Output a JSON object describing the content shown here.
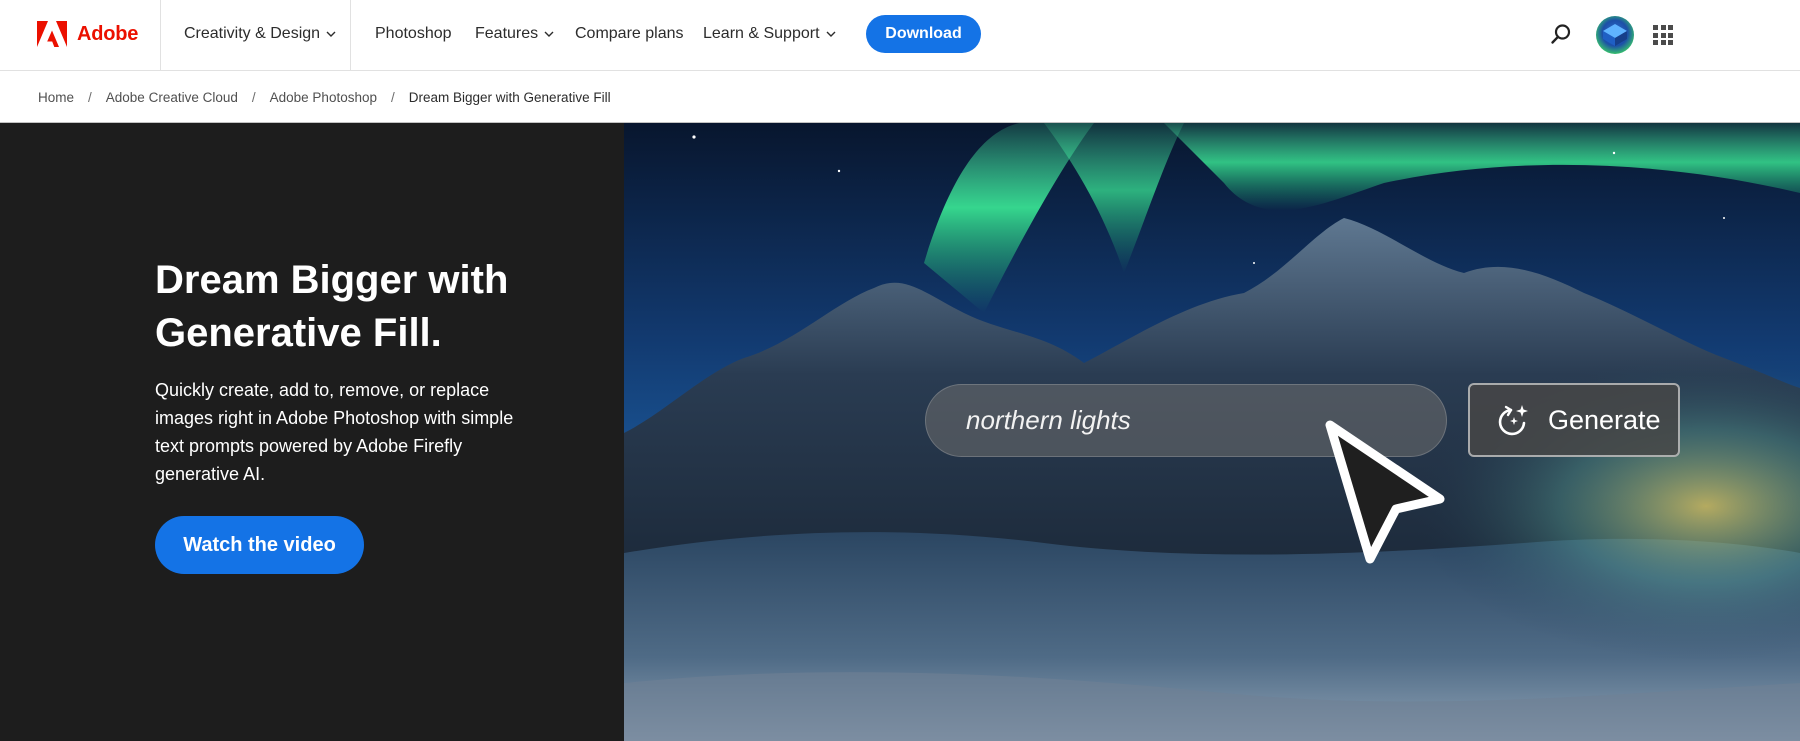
{
  "brand": {
    "name": "Adobe",
    "color": "#eb1000",
    "logo_icon": "adobe-logo-icon"
  },
  "nav": {
    "creativity_design": "Creativity & Design",
    "photoshop": "Photoshop",
    "features": "Features",
    "compare_plans": "Compare plans",
    "learn_support": "Learn & Support",
    "download": "Download",
    "icons": [
      "search-icon",
      "avatar",
      "apps-grid-icon"
    ]
  },
  "breadcrumb": {
    "items": [
      "Home",
      "Adobe Creative Cloud",
      "Adobe Photoshop"
    ],
    "separator": "/",
    "current": "Dream Bigger with Generative Fill"
  },
  "hero": {
    "title": "Dream Bigger with Generative Fill.",
    "description": "Quickly create, add to, remove, or replace images right in Adobe Photoshop with simple text prompts powered by Adobe Firefly generative AI.",
    "cta": "Watch the video",
    "prompt_value": "northern lights",
    "generate_label": "Generate"
  },
  "colors": {
    "accent": "#1473e6",
    "hero_bg": "#1d1d1d"
  }
}
